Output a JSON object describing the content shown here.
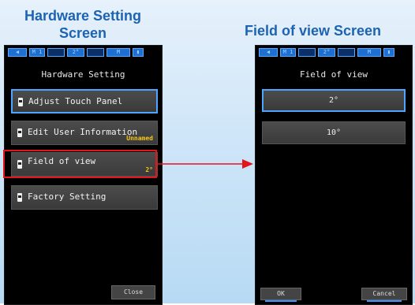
{
  "captions": {
    "left_line1": "Hardware Setting",
    "left_line2": "Screen",
    "right": "Field of view Screen"
  },
  "status_bar": {
    "mode": "M 1",
    "angle": "2°",
    "memory": "M"
  },
  "hardware_screen": {
    "title": "Hardware Setting",
    "items": [
      {
        "label": "Adjust Touch Panel",
        "value": ""
      },
      {
        "label": "Edit User Information",
        "value": "Unnamed"
      },
      {
        "label": "Field of view",
        "value": "2°"
      },
      {
        "label": "Factory Setting",
        "value": ""
      }
    ],
    "close_label": "Close"
  },
  "fov_screen": {
    "title": "Field of view",
    "options": [
      "2°",
      "10°"
    ],
    "ok_label": "OK",
    "cancel_label": "Cancel"
  },
  "colors": {
    "caption": "#1d63b1",
    "highlight": "#e2141c",
    "selection": "#4aa6ff",
    "value_text": "#f5c518"
  }
}
